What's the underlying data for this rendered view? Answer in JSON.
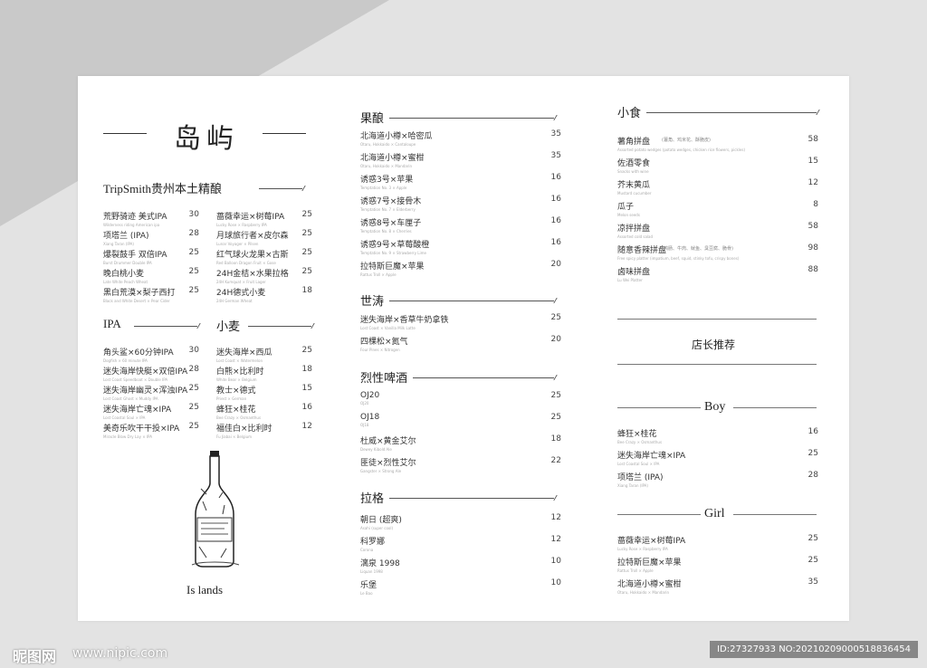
{
  "logo": {
    "text": "岛屿"
  },
  "islands_caption": "Is lands",
  "col1": {
    "section1": {
      "title": "TripSmith贵州本土精酿",
      "left": [
        {
          "name": "荒野骑迹 美式IPA",
          "sub": "Wilderness riding American ipa",
          "price": "30"
        },
        {
          "name": "项塔兰 (IPA)",
          "sub": "Xiang Taran (IPA)",
          "price": "28"
        },
        {
          "name": "爆裂鼓手 双倍IPA",
          "sub": "Burst Drummer Double IPA",
          "price": "25"
        },
        {
          "name": "晚白桃小麦",
          "sub": "Late White Peach Wheat",
          "price": "25"
        },
        {
          "name": "黑白荒漠×梨子西打",
          "sub": "Black and White Desert × Pear Cider",
          "price": "25"
        }
      ],
      "right": [
        {
          "name": "蔷薇幸运×树莓IPA",
          "sub": "Lucky Rose × Raspberry IPA",
          "price": "25"
        },
        {
          "name": "月球旅行者×皮尔森",
          "sub": "Lunar Voyager × Pilsen",
          "price": "25"
        },
        {
          "name": "红气球火龙果×古斯",
          "sub": "Red Balloon Dragon Fruit × Gose",
          "price": "25"
        },
        {
          "name": "24H金桔×水果拉格",
          "sub": "24H Kumquat × Fruit Lager",
          "price": "25"
        },
        {
          "name": "24H德式小麦",
          "sub": "24H German Wheat",
          "price": "18"
        }
      ]
    },
    "ipa": {
      "title": "IPA",
      "items": [
        {
          "name": "角头鲨×60分钟IPA",
          "sub": "Dogfish × 60 minute IPA",
          "price": "30"
        },
        {
          "name": "迷失海岸快艇×双倍IPA",
          "sub": "Lost Coast Speedboat × Double IPA",
          "price": "28"
        },
        {
          "name": "迷失海岸幽灵×浑浊IPA",
          "sub": "Lost Coast Ghost × Muddy IPA",
          "price": "25"
        },
        {
          "name": "迷失海岸亡魂×IPA",
          "sub": "Lost Coastal Soul × IPA",
          "price": "25"
        },
        {
          "name": "美奇乐吹干干投×IPA",
          "sub": "Miracle Blow Dry Lay × IPA",
          "price": "25"
        }
      ]
    },
    "wheat": {
      "title": "小麦",
      "items": [
        {
          "name": "迷失海岸×西瓜",
          "sub": "Lost Coast × Watermelon",
          "price": "25"
        },
        {
          "name": "白熊×比利时",
          "sub": "White Bear × Belgium",
          "price": "18"
        },
        {
          "name": "教士×德式",
          "sub": "Priest × German",
          "price": "15"
        },
        {
          "name": "蜂狂×桂花",
          "sub": "Bee Crazy × Osmanthus",
          "price": "16"
        },
        {
          "name": "福佳白×比利时",
          "sub": "Fu Jiabai × Belgium",
          "price": "12"
        }
      ]
    }
  },
  "col2": {
    "fruit": {
      "title": "果酿",
      "items": [
        {
          "name": "北海道小樽×哈密瓜",
          "sub": "Otaru, Hokkaido × Cantaloupe",
          "price": "35"
        },
        {
          "name": "北海道小樽×蜜柑",
          "sub": "Otaru, Hokkaido × Mandarin",
          "price": "35"
        },
        {
          "name": "诱惑3号×苹果",
          "sub": "Temptation No. 3 × Apple",
          "price": "16"
        },
        {
          "name": "诱惑7号×接骨木",
          "sub": "Temptation No. 7 × Elderberry",
          "price": "16"
        },
        {
          "name": "诱惑8号×车厘子",
          "sub": "Temptation No. 8 × Cherries",
          "price": "16"
        },
        {
          "name": "诱惑9号×草莓酸橙",
          "sub": "Temptation No. 9 × Strawberry Lime",
          "price": "16"
        },
        {
          "name": "拉特斯巨魔×苹果",
          "sub": "Rattus Troll × Apple",
          "price": "20"
        }
      ]
    },
    "stout": {
      "title": "世涛",
      "items": [
        {
          "name": "迷失海岸×香草牛奶拿铁",
          "sub": "Lost Coast × Vanilla Milk Latte",
          "price": "25"
        },
        {
          "name": "四棵松×氮气",
          "sub": "Four Pines × Nitrogen",
          "price": "20"
        }
      ]
    },
    "strong": {
      "title": "烈性啤酒",
      "items": [
        {
          "name": "OJ20",
          "sub": "OJ20",
          "price": "25"
        },
        {
          "name": "OJ18",
          "sub": "OJ18",
          "price": "25"
        },
        {
          "name": "杜威×黄金艾尔",
          "sub": "Dewey Kibold Ale",
          "price": "18"
        },
        {
          "name": "匪徒×烈性艾尔",
          "sub": "Gangster × Strong Ale",
          "price": "22"
        }
      ]
    },
    "lager": {
      "title": "拉格",
      "items": [
        {
          "name": "朝日 (超爽)",
          "sub": "Asahi (super cool)",
          "price": "12"
        },
        {
          "name": "科罗娜",
          "sub": "Corona",
          "price": "12"
        },
        {
          "name": "漓泉 1998",
          "sub": "Liquan 1998",
          "price": "10"
        },
        {
          "name": "乐堡",
          "sub": "Le Bao",
          "price": "10"
        }
      ]
    }
  },
  "col3": {
    "snacks": {
      "title": "小食",
      "items": [
        {
          "name": "薯角拼盘",
          "tag": "(薯角、鸡米花、酥脆皮)",
          "sub": "Assorted potato wedges (potato wedges, chicken rice flowers, pickles)",
          "price": "58"
        },
        {
          "name": "佐酒零食",
          "tag": "",
          "sub": "Snacks with wine",
          "price": "15"
        },
        {
          "name": "芥末黄瓜",
          "tag": "",
          "sub": "Mustard cucumber",
          "price": "12"
        },
        {
          "name": "瓜子",
          "tag": "",
          "sub": "Melon seeds",
          "price": "8"
        },
        {
          "name": "凉拌拼盘",
          "tag": "",
          "sub": "Assorted cold salad",
          "price": "58"
        },
        {
          "name": "随意香辣拼盘",
          "tag": "(鸭肠、牛肉、鱿鱼、臭豆腐、脆骨)",
          "sub": "Free spicy platter (impatium, beef, squid, stinky tofu, crispy bones)",
          "price": "98"
        },
        {
          "name": "卤味拼盘",
          "tag": "",
          "sub": "Lu Wei Platter",
          "price": "88"
        }
      ]
    },
    "recommend": {
      "title": "店长推荐"
    },
    "boy": {
      "title": "Boy",
      "items": [
        {
          "name": "蜂狂×桂花",
          "sub": "Bee Crazy × Osmanthus",
          "price": "16"
        },
        {
          "name": "迷失海岸亡魂×IPA",
          "sub": "Lost Coastal Soul × IPA",
          "price": "25"
        },
        {
          "name": "项塔兰 (IPA)",
          "sub": "Xiang Taran (IPA)",
          "price": "28"
        }
      ]
    },
    "girl": {
      "title": "Girl",
      "items": [
        {
          "name": "蔷薇幸运×树莓IPA",
          "sub": "Lucky Rose × Raspberry IPA",
          "price": "25"
        },
        {
          "name": "拉特斯巨魔×苹果",
          "sub": "Rattus Troll × Apple",
          "price": "25"
        },
        {
          "name": "北海道小樽×蜜柑",
          "sub": "Otaru, Hokkaido × Mandarin",
          "price": "35"
        }
      ]
    }
  },
  "footer": {
    "watermark": "昵图网",
    "url": "www.nipic.com",
    "id_text": "ID:27327933 NO:20210209000518836454"
  }
}
